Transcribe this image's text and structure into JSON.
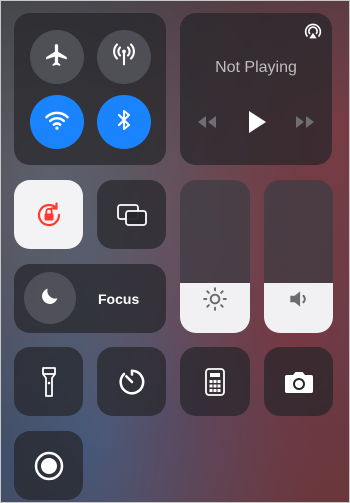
{
  "connectivity": {
    "airplane": {
      "icon": "airplane-icon",
      "active": false
    },
    "cellular": {
      "icon": "antenna-icon",
      "active": false
    },
    "wifi": {
      "icon": "wifi-icon",
      "active": true
    },
    "bluetooth": {
      "icon": "bluetooth-icon",
      "active": true
    },
    "accent_color": "#1a84ff"
  },
  "now_playing": {
    "title": "Not Playing",
    "airplay_icon": "airplay-icon",
    "controls": [
      "rewind-icon",
      "play-icon",
      "fast-forward-icon"
    ]
  },
  "toggles": {
    "orientation_lock": {
      "icon": "orientation-lock-icon",
      "active": true,
      "color": "#ff3b30"
    },
    "screen_mirroring": {
      "icon": "screen-mirroring-icon"
    }
  },
  "focus": {
    "label": "Focus",
    "icon": "moon-icon"
  },
  "sliders": {
    "brightness": {
      "icon": "sun-icon",
      "level": 0.33
    },
    "volume": {
      "icon": "speaker-icon",
      "level": 0.33
    }
  },
  "bottom_row": [
    {
      "icon": "flashlight-icon"
    },
    {
      "icon": "timer-icon"
    },
    {
      "icon": "calculator-icon"
    },
    {
      "icon": "camera-icon"
    }
  ],
  "screen_record": {
    "icon": "screen-record-icon"
  }
}
